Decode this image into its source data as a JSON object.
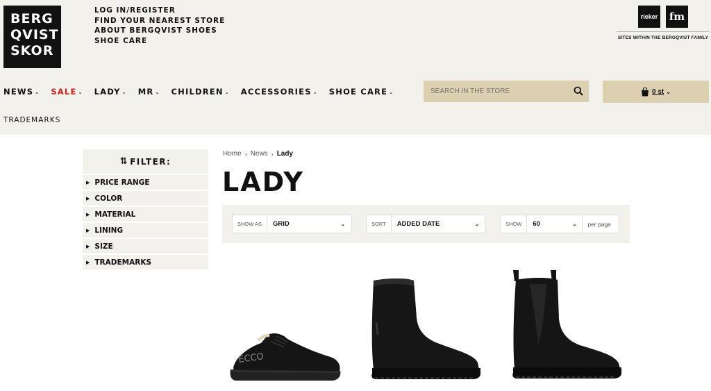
{
  "brand": {
    "logo_lines": [
      "BERG",
      "QVIST",
      "SKOR"
    ]
  },
  "top_links": [
    "LOG IN/REGISTER",
    "FIND YOUR NEAREST STORE",
    "ABOUT BERGQVIST SHOES",
    "SHOE CARE"
  ],
  "family": {
    "logos": [
      "rieker",
      "fm"
    ],
    "label": "SITES WITHIN THE BERGQVIST FAMILY"
  },
  "nav": {
    "items": [
      {
        "label": "NEWS",
        "has_menu": true
      },
      {
        "label": "SALE",
        "has_menu": true,
        "color": "#d3201b"
      },
      {
        "label": "LADY",
        "has_menu": true
      },
      {
        "label": "MR",
        "has_menu": true
      },
      {
        "label": "CHILDREN",
        "has_menu": true
      },
      {
        "label": "ACCESSORIES",
        "has_menu": true
      },
      {
        "label": "SHOE CARE",
        "has_menu": true
      }
    ],
    "trademarks": "TRADEMARKS"
  },
  "search": {
    "placeholder": "SEARCH IN THE STORE",
    "icon": "search-icon"
  },
  "cart": {
    "count": "0 st",
    "icon": "shopping-bag-icon"
  },
  "filter": {
    "title": "FILTER:",
    "items": [
      "PRICE RANGE",
      "COLOR",
      "MATERIAL",
      "LINING",
      "SIZE",
      "TRADEMARKS"
    ]
  },
  "breadcrumb": {
    "items": [
      "Home",
      "News"
    ],
    "current": "Lady"
  },
  "page_title": "LADY",
  "toolbar": {
    "show_as": {
      "label": "SHOW AS",
      "value": "GRID"
    },
    "sort": {
      "label": "SORT",
      "value": "ADDED DATE"
    },
    "per_page": {
      "label": "SHOW",
      "value": "60",
      "suffix": "per page"
    }
  },
  "products": [
    {
      "name": "sneaker",
      "brand_text": "ECCO"
    },
    {
      "name": "ankle-boot"
    },
    {
      "name": "chelsea-boot"
    }
  ],
  "colors": {
    "background": "#f2f1ec",
    "accent": "#dcd0b0",
    "sale": "#d3201b"
  }
}
